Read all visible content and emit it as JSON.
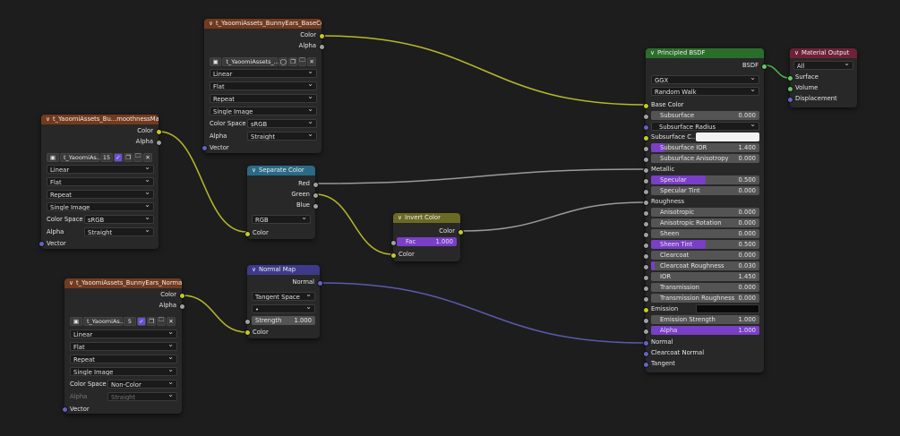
{
  "nodes": {
    "basecolor": {
      "title": "t_YaoomiAssets_BunnyEars_BaseColor.p...",
      "out_color": "Color",
      "out_alpha": "Alpha",
      "image_name": "t_YaoomiAssets_...",
      "interpolation": "Linear",
      "projection": "Flat",
      "extension": "Repeat",
      "source": "Single Image",
      "color_space_label": "Color Space",
      "color_space": "sRGB",
      "alpha_label": "Alpha",
      "alpha": "Straight",
      "in_vector": "Vector"
    },
    "smoothness": {
      "title": "t_YaoomiAssets_Bu...moothnessMaps.png",
      "out_color": "Color",
      "out_alpha": "Alpha",
      "image_name": "t_YaoomiAs...",
      "users": "15",
      "interpolation": "Linear",
      "projection": "Flat",
      "extension": "Repeat",
      "source": "Single Image",
      "color_space_label": "Color Space",
      "color_space": "sRGB",
      "alpha_label": "Alpha",
      "alpha": "Straight",
      "in_vector": "Vector"
    },
    "normalmap_tex": {
      "title": "t_YaoomiAssets_BunnyEars_NormalMap....",
      "out_color": "Color",
      "out_alpha": "Alpha",
      "image_name": "t_YaoomiAs...",
      "users": "5",
      "interpolation": "Linear",
      "projection": "Flat",
      "extension": "Repeat",
      "source": "Single Image",
      "color_space_label": "Color Space",
      "color_space": "Non-Color",
      "alpha_label": "Alpha",
      "alpha": "Straight",
      "in_vector": "Vector"
    },
    "separate": {
      "title": "Separate Color",
      "out_red": "Red",
      "out_green": "Green",
      "out_blue": "Blue",
      "mode": "RGB",
      "in_color": "Color"
    },
    "normalmap": {
      "title": "Normal Map",
      "out_normal": "Normal",
      "space": "Tangent Space",
      "uv": "•",
      "strength_label": "Strength",
      "strength": "1.000",
      "in_color": "Color"
    },
    "invert": {
      "title": "Invert Color",
      "out_color": "Color",
      "fac_label": "Fac",
      "fac": "1.000",
      "in_color": "Color"
    },
    "bsdf": {
      "title": "Principled BSDF",
      "out_bsdf": "BSDF",
      "distribution": "GGX",
      "subsurface_method": "Random Walk",
      "base_color": "Base Color",
      "subsurface_label": "Subsurface",
      "subsurface": "0.000",
      "subsurface_radius": "Subsurface Radius",
      "subsurface_color_label": "Subsurface C...",
      "subsurface_ior_label": "Subsurface IOR",
      "subsurface_ior": "1.400",
      "subsurface_aniso_label": "Subsurface Anisotropy",
      "subsurface_aniso": "0.000",
      "metallic": "Metallic",
      "specular_label": "Specular",
      "specular": "0.500",
      "specular_tint_label": "Specular Tint",
      "specular_tint": "0.000",
      "roughness": "Roughness",
      "anisotropic_label": "Anisotropic",
      "anisotropic": "0.000",
      "aniso_rot_label": "Anisotropic Rotation",
      "aniso_rot": "0.000",
      "sheen_label": "Sheen",
      "sheen": "0.000",
      "sheen_tint_label": "Sheen Tint",
      "sheen_tint": "0.500",
      "clearcoat_label": "Clearcoat",
      "clearcoat": "0.000",
      "clearcoat_rough_label": "Clearcoat Roughness",
      "clearcoat_rough": "0.030",
      "ior_label": "IOR",
      "ior": "1.450",
      "transmission_label": "Transmission",
      "transmission": "0.000",
      "trans_rough_label": "Transmission Roughness",
      "trans_rough": "0.000",
      "emission": "Emission",
      "emission_strength_label": "Emission Strength",
      "emission_strength": "1.000",
      "alpha_label": "Alpha",
      "alpha": "1.000",
      "normal": "Normal",
      "clearcoat_normal": "Clearcoat Normal",
      "tangent": "Tangent"
    },
    "output": {
      "title": "Material Output",
      "target": "All",
      "surface": "Surface",
      "volume": "Volume",
      "displacement": "Displacement"
    }
  },
  "colors": {
    "socket_color": "#c7c729",
    "socket_float": "#a1a1a1",
    "socket_vector": "#6363c7",
    "socket_shader": "#63c763",
    "wire_color": "#b8b82a",
    "wire_float": "#9a9a9a",
    "wire_vector": "#5a5ab0",
    "wire_shader": "#4fb04f"
  }
}
